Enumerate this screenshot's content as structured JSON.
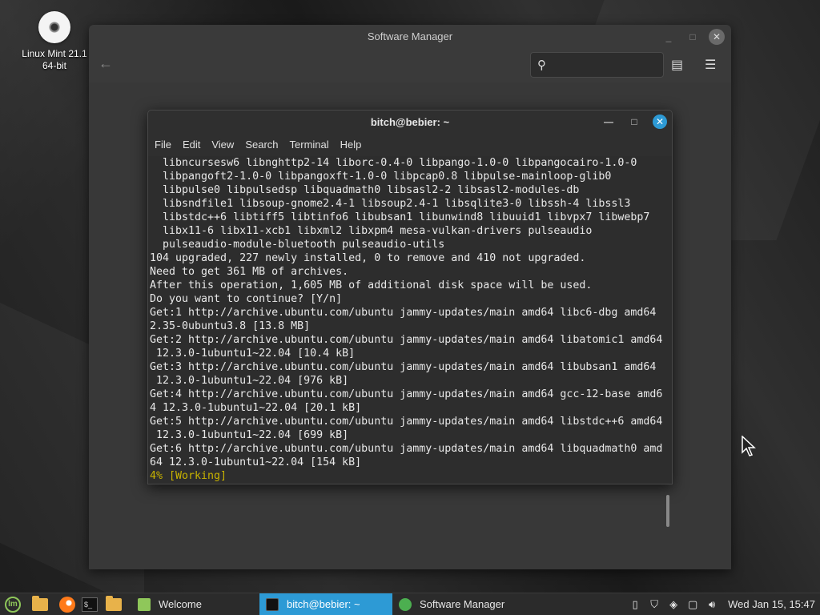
{
  "desktop": {
    "icon_label_line1": "Linux Mint 21.1",
    "icon_label_line2": "64-bit"
  },
  "software_manager": {
    "title": "Software Manager",
    "search_placeholder": ""
  },
  "terminal": {
    "title": "bitch@bebier: ~",
    "menu": [
      "File",
      "Edit",
      "View",
      "Search",
      "Terminal",
      "Help"
    ],
    "lines": [
      "  libncursesw6 libnghttp2-14 liborc-0.4-0 libpango-1.0-0 libpangocairo-1.0-0",
      "  libpangoft2-1.0-0 libpangoxft-1.0-0 libpcap0.8 libpulse-mainloop-glib0",
      "  libpulse0 libpulsedsp libquadmath0 libsasl2-2 libsasl2-modules-db",
      "  libsndfile1 libsoup-gnome2.4-1 libsoup2.4-1 libsqlite3-0 libssh-4 libssl3",
      "  libstdc++6 libtiff5 libtinfo6 libubsan1 libunwind8 libuuid1 libvpx7 libwebp7",
      "  libx11-6 libx11-xcb1 libxml2 libxpm4 mesa-vulkan-drivers pulseaudio",
      "  pulseaudio-module-bluetooth pulseaudio-utils",
      "104 upgraded, 227 newly installed, 0 to remove and 410 not upgraded.",
      "Need to get 361 MB of archives.",
      "After this operation, 1,605 MB of additional disk space will be used.",
      "Do you want to continue? [Y/n]",
      "Get:1 http://archive.ubuntu.com/ubuntu jammy-updates/main amd64 libc6-dbg amd64",
      "2.35-0ubuntu3.8 [13.8 MB]",
      "Get:2 http://archive.ubuntu.com/ubuntu jammy-updates/main amd64 libatomic1 amd64",
      " 12.3.0-1ubuntu1~22.04 [10.4 kB]",
      "Get:3 http://archive.ubuntu.com/ubuntu jammy-updates/main amd64 libubsan1 amd64",
      " 12.3.0-1ubuntu1~22.04 [976 kB]",
      "Get:4 http://archive.ubuntu.com/ubuntu jammy-updates/main amd64 gcc-12-base amd6",
      "4 12.3.0-1ubuntu1~22.04 [20.1 kB]",
      "Get:5 http://archive.ubuntu.com/ubuntu jammy-updates/main amd64 libstdc++6 amd64",
      " 12.3.0-1ubuntu1~22.04 [699 kB]",
      "Get:6 http://archive.ubuntu.com/ubuntu jammy-updates/main amd64 libquadmath0 amd",
      "64 12.3.0-1ubuntu1~22.04 [154 kB]"
    ],
    "progress_line": "4% [Working]"
  },
  "taskbar": {
    "tasks": [
      {
        "label": "Welcome",
        "icon": "welcome-icon",
        "color": "#8fc75a"
      },
      {
        "label": "bitch@bebier: ~",
        "icon": "terminal-icon",
        "color": "#111111"
      },
      {
        "label": "Software Manager",
        "icon": "software-manager-icon",
        "color": "#4caf50"
      }
    ],
    "clock": "Wed Jan 15, 15:47"
  },
  "colors": {
    "accent": "#2d9ad5",
    "terminal_progress": "#c8b300"
  }
}
